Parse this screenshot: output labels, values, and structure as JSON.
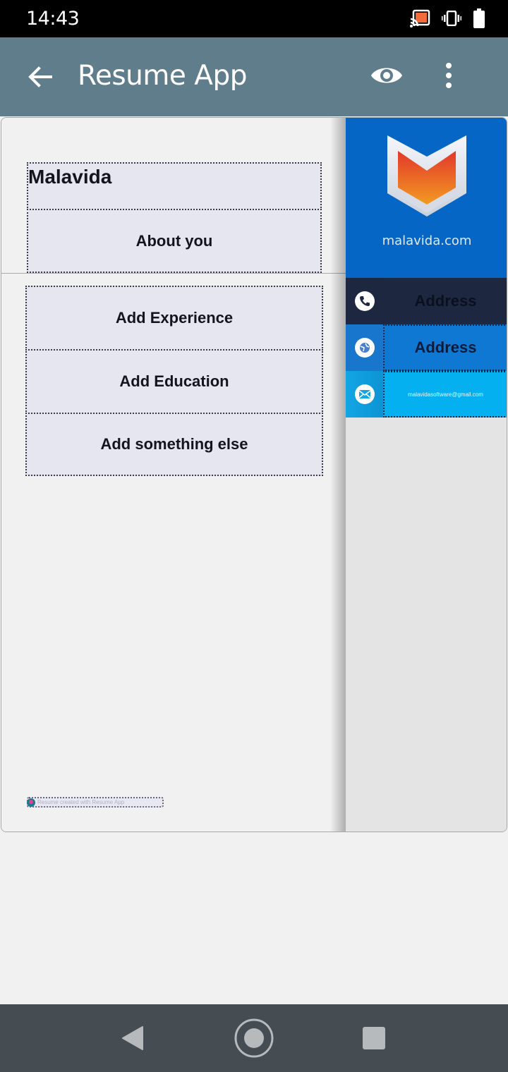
{
  "status_bar": {
    "time": "14:43",
    "icons": [
      "cast-icon",
      "vibrate-icon",
      "battery-icon"
    ]
  },
  "app_bar": {
    "title": "Resume App",
    "back_icon": "arrow-back-icon",
    "actions": [
      "eye-icon",
      "more-vert-icon"
    ]
  },
  "resume": {
    "name": "Malavida",
    "sections": [
      {
        "label": "About you"
      },
      {
        "label": "Add Experience"
      },
      {
        "label": "Add Education"
      },
      {
        "label": "Add something else"
      }
    ],
    "footer_note": "Resume created with Resume App",
    "sidebar": {
      "logo_caption": "malavida.com",
      "contacts": [
        {
          "icon": "phone-icon",
          "value": "Address",
          "color": "#1d2740"
        },
        {
          "icon": "globe-icon",
          "value": "Address",
          "color": "#0f78d2"
        },
        {
          "icon": "mail-icon",
          "value": "malavidasoftware@gmail.com",
          "color": "#04b0f0"
        }
      ]
    }
  },
  "nav_bar": {
    "buttons": [
      "back-nav-icon",
      "home-nav-icon",
      "recents-nav-icon"
    ]
  },
  "colors": {
    "app_bar": "#607d8b",
    "logo_panel": "#0566c6",
    "nav_bar": "#454c52"
  }
}
